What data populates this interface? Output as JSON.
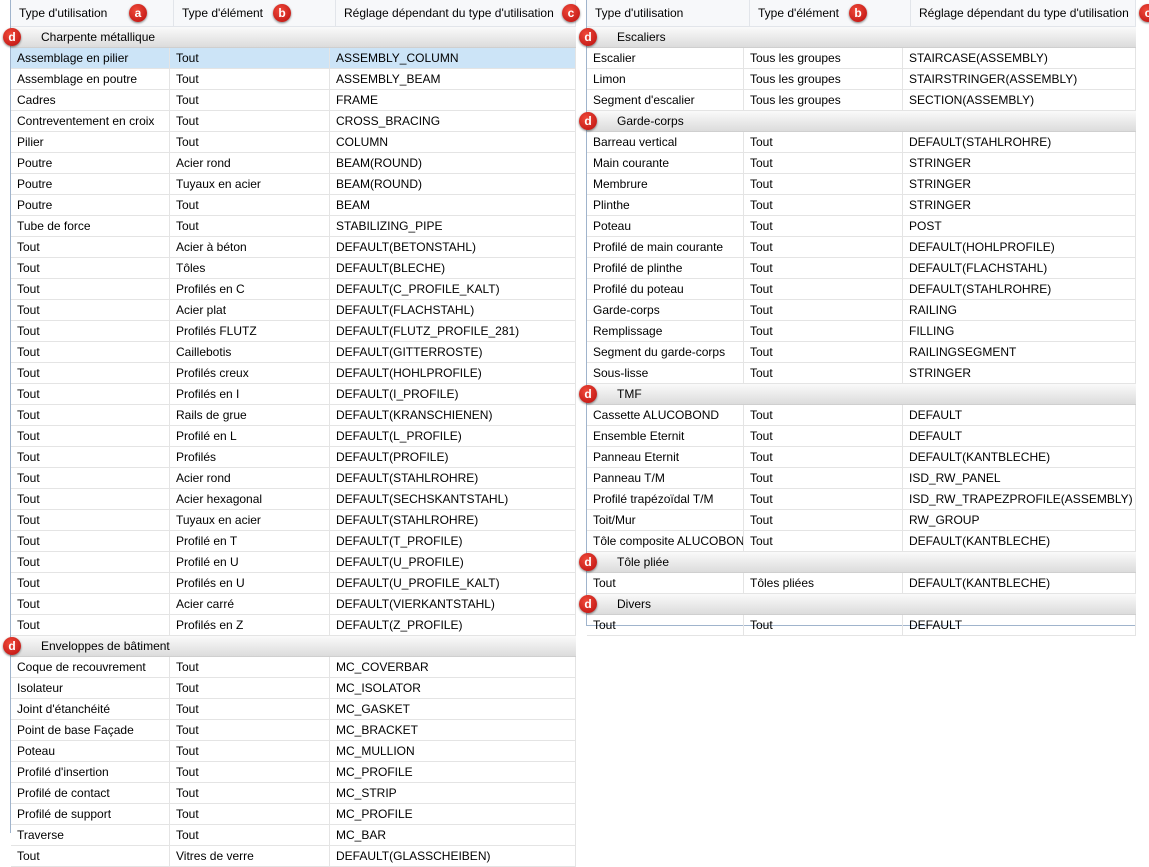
{
  "badge_color": "#d21f1a",
  "selected_row_color": "#cce4f7",
  "left": {
    "headers": [
      "Type d'utilisation",
      "Type d'élément",
      "Réglage dépendant du type d'utilisation"
    ],
    "header_badges": [
      "a",
      "b",
      "c"
    ],
    "groups": [
      {
        "title": "Charpente métallique",
        "badge": "d",
        "rows": [
          [
            "Assemblage en pilier",
            "Tout",
            "ASSEMBLY_COLUMN"
          ],
          [
            "Assemblage en poutre",
            "Tout",
            "ASSEMBLY_BEAM"
          ],
          [
            "Cadres",
            "Tout",
            "FRAME"
          ],
          [
            "Contreventement en croix",
            "Tout",
            "CROSS_BRACING"
          ],
          [
            "Pilier",
            "Tout",
            "COLUMN"
          ],
          [
            "Poutre",
            "Acier rond",
            "BEAM(ROUND)"
          ],
          [
            "Poutre",
            "Tuyaux en acier",
            "BEAM(ROUND)"
          ],
          [
            "Poutre",
            "Tout",
            "BEAM"
          ],
          [
            "Tube de force",
            "Tout",
            "STABILIZING_PIPE"
          ],
          [
            "Tout",
            "Acier à béton",
            "DEFAULT(BETONSTAHL)"
          ],
          [
            "Tout",
            "Tôles",
            "DEFAULT(BLECHE)"
          ],
          [
            "Tout",
            "Profilés en C",
            "DEFAULT(C_PROFILE_KALT)"
          ],
          [
            "Tout",
            "Acier plat",
            "DEFAULT(FLACHSTAHL)"
          ],
          [
            "Tout",
            "Profilés FLUTZ",
            "DEFAULT(FLUTZ_PROFILE_281)"
          ],
          [
            "Tout",
            "Caillebotis",
            "DEFAULT(GITTERROSTE)"
          ],
          [
            "Tout",
            "Profilés creux",
            "DEFAULT(HOHLPROFILE)"
          ],
          [
            "Tout",
            "Profilés en I",
            "DEFAULT(I_PROFILE)"
          ],
          [
            "Tout",
            "Rails de grue",
            "DEFAULT(KRANSCHIENEN)"
          ],
          [
            "Tout",
            "Profilé en L",
            "DEFAULT(L_PROFILE)"
          ],
          [
            "Tout",
            "Profilés",
            "DEFAULT(PROFILE)"
          ],
          [
            "Tout",
            "Acier rond",
            "DEFAULT(STAHLROHRE)"
          ],
          [
            "Tout",
            "Acier hexagonal",
            "DEFAULT(SECHSKANTSTAHL)"
          ],
          [
            "Tout",
            "Tuyaux en acier",
            "DEFAULT(STAHLROHRE)"
          ],
          [
            "Tout",
            "Profilé en T",
            "DEFAULT(T_PROFILE)"
          ],
          [
            "Tout",
            "Profilé en U",
            "DEFAULT(U_PROFILE)"
          ],
          [
            "Tout",
            "Profilés en U",
            "DEFAULT(U_PROFILE_KALT)"
          ],
          [
            "Tout",
            "Acier carré",
            "DEFAULT(VIERKANTSTAHL)"
          ],
          [
            "Tout",
            "Profilés en Z",
            "DEFAULT(Z_PROFILE)"
          ]
        ]
      },
      {
        "title": "Enveloppes de bâtiment",
        "badge": "d",
        "rows": [
          [
            "Coque de recouvrement",
            "Tout",
            "MC_COVERBAR"
          ],
          [
            "Isolateur",
            "Tout",
            "MC_ISOLATOR"
          ],
          [
            "Joint d'étanchéité",
            "Tout",
            "MC_GASKET"
          ],
          [
            "Point de base Façade",
            "Tout",
            "MC_BRACKET"
          ],
          [
            "Poteau",
            "Tout",
            "MC_MULLION"
          ],
          [
            "Profilé d'insertion",
            "Tout",
            "MC_PROFILE"
          ],
          [
            "Profilé de contact",
            "Tout",
            "MC_STRIP"
          ],
          [
            "Profilé de support",
            "Tout",
            "MC_PROFILE"
          ],
          [
            "Traverse",
            "Tout",
            "MC_BAR"
          ],
          [
            "Tout",
            "Vitres de verre",
            "DEFAULT(GLASSCHEIBEN)"
          ]
        ]
      }
    ]
  },
  "right": {
    "headers": [
      "Type d'utilisation",
      "Type d'élément",
      "Réglage dépendant du type d'utilisation"
    ],
    "header_badges": [
      "",
      "b",
      "c"
    ],
    "groups": [
      {
        "title": "Escaliers",
        "badge": "d",
        "rows": [
          [
            "Escalier",
            "Tous les groupes",
            "STAIRCASE(ASSEMBLY)"
          ],
          [
            "Limon",
            "Tous les groupes",
            "STAIRSTRINGER(ASSEMBLY)"
          ],
          [
            "Segment d'escalier",
            "Tous les groupes",
            "SECTION(ASSEMBLY)"
          ]
        ]
      },
      {
        "title": "Garde-corps",
        "badge": "d",
        "rows": [
          [
            "Barreau vertical",
            "Tout",
            "DEFAULT(STAHLROHRE)"
          ],
          [
            "Main courante",
            "Tout",
            "STRINGER"
          ],
          [
            "Membrure",
            "Tout",
            "STRINGER"
          ],
          [
            "Plinthe",
            "Tout",
            "STRINGER"
          ],
          [
            "Poteau",
            "Tout",
            "POST"
          ],
          [
            "Profilé de main courante",
            "Tout",
            "DEFAULT(HOHLPROFILE)"
          ],
          [
            "Profilé de plinthe",
            "Tout",
            "DEFAULT(FLACHSTAHL)"
          ],
          [
            "Profilé du poteau",
            "Tout",
            "DEFAULT(STAHLROHRE)"
          ],
          [
            "Garde-corps",
            "Tout",
            "RAILING"
          ],
          [
            "Remplissage",
            "Tout",
            "FILLING"
          ],
          [
            "Segment du garde-corps",
            "Tout",
            "RAILINGSEGMENT"
          ],
          [
            "Sous-lisse",
            "Tout",
            "STRINGER"
          ]
        ]
      },
      {
        "title": "TMF",
        "badge": "d",
        "rows": [
          [
            "Cassette ALUCOBOND",
            "Tout",
            "DEFAULT"
          ],
          [
            "Ensemble Eternit",
            "Tout",
            "DEFAULT"
          ],
          [
            "Panneau Eternit",
            "Tout",
            "DEFAULT(KANTBLECHE)"
          ],
          [
            "Panneau T/M",
            "Tout",
            "ISD_RW_PANEL"
          ],
          [
            "Profilé trapézoïdal T/M",
            "Tout",
            "ISD_RW_TRAPEZPROFILE(ASSEMBLY)"
          ],
          [
            "Toit/Mur",
            "Tout",
            "RW_GROUP"
          ],
          [
            "Tôle composite ALUCOBOND",
            "Tout",
            "DEFAULT(KANTBLECHE)"
          ]
        ]
      },
      {
        "title": "Tôle pliée",
        "badge": "d",
        "rows": [
          [
            "Tout",
            "Tôles pliées",
            "DEFAULT(KANTBLECHE)"
          ]
        ]
      },
      {
        "title": "Divers",
        "badge": "d",
        "rows": [
          [
            "Tout",
            "Tout",
            "DEFAULT"
          ]
        ]
      }
    ]
  }
}
